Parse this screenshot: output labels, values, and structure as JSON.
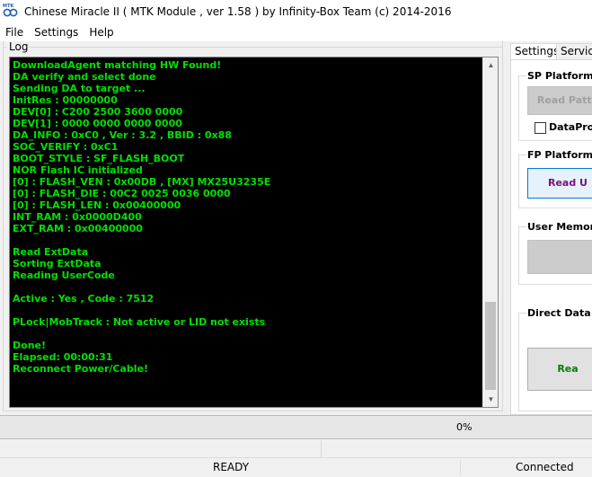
{
  "window": {
    "title": "Chinese Miracle II ( MTK Module , ver 1.58 ) by Infinity-Box Team (c) 2014-2016",
    "icon_text": "MTK"
  },
  "menu": [
    "File",
    "Settings",
    "Help"
  ],
  "log": {
    "label": "Log",
    "text_color": "#00e000",
    "background": "#000000",
    "lines": [
      "DownloadAgent matching HW Found!",
      "DA verify and select done",
      "Sending DA to target ...",
      "InitRes : 00000000",
      "DEV[0] : C200 2500 3600 0000",
      "DEV[1] : 0000 0000 0000 0000",
      "DA_INFO   : 0xC0 , Ver : 3.2 , BBID : 0x88",
      "SOC_VERIFY : 0xC1",
      "BOOT_STYLE : SF_FLASH_BOOT",
      "NOR Flash IC initialized",
      "[0] : FLASH_VEN : 0x00DB , [MX] MX25U3235E",
      "[0] : FLASH_DIE : 00C2 0025 0036 0000",
      "[0] : FLASH_LEN : 0x00400000",
      "INT_RAM : 0x0000D400",
      "EXT_RAM : 0x00400000",
      "",
      "Read ExtData",
      "Sorting ExtData",
      "Reading UserCode",
      "",
      "Active : Yes , Code : 7512",
      "",
      "PLock|MobTrack : Not active or LID not exists",
      "",
      "Done!",
      "Elapsed: 00:00:31",
      "Reconnect Power/Cable!"
    ]
  },
  "tabs": [
    {
      "label": "Settings",
      "active": true
    },
    {
      "label": "Service",
      "active": false
    }
  ],
  "groups": {
    "sp_platform": {
      "title": "SP Platform [",
      "button": "Read Patte",
      "checkbox_label": "DataProt"
    },
    "fp_platform": {
      "title": "FP Platform [",
      "button": "Read U",
      "button_color": "#7b0f7b"
    },
    "user_memory": {
      "title": "User Memory"
    },
    "direct_data": {
      "title": "Direct Data R",
      "button": "Rea",
      "button_color": "#0c7a0c"
    }
  },
  "progress": {
    "text": "0%",
    "value": 0
  },
  "status": {
    "state": "READY",
    "connection": "Connected"
  }
}
